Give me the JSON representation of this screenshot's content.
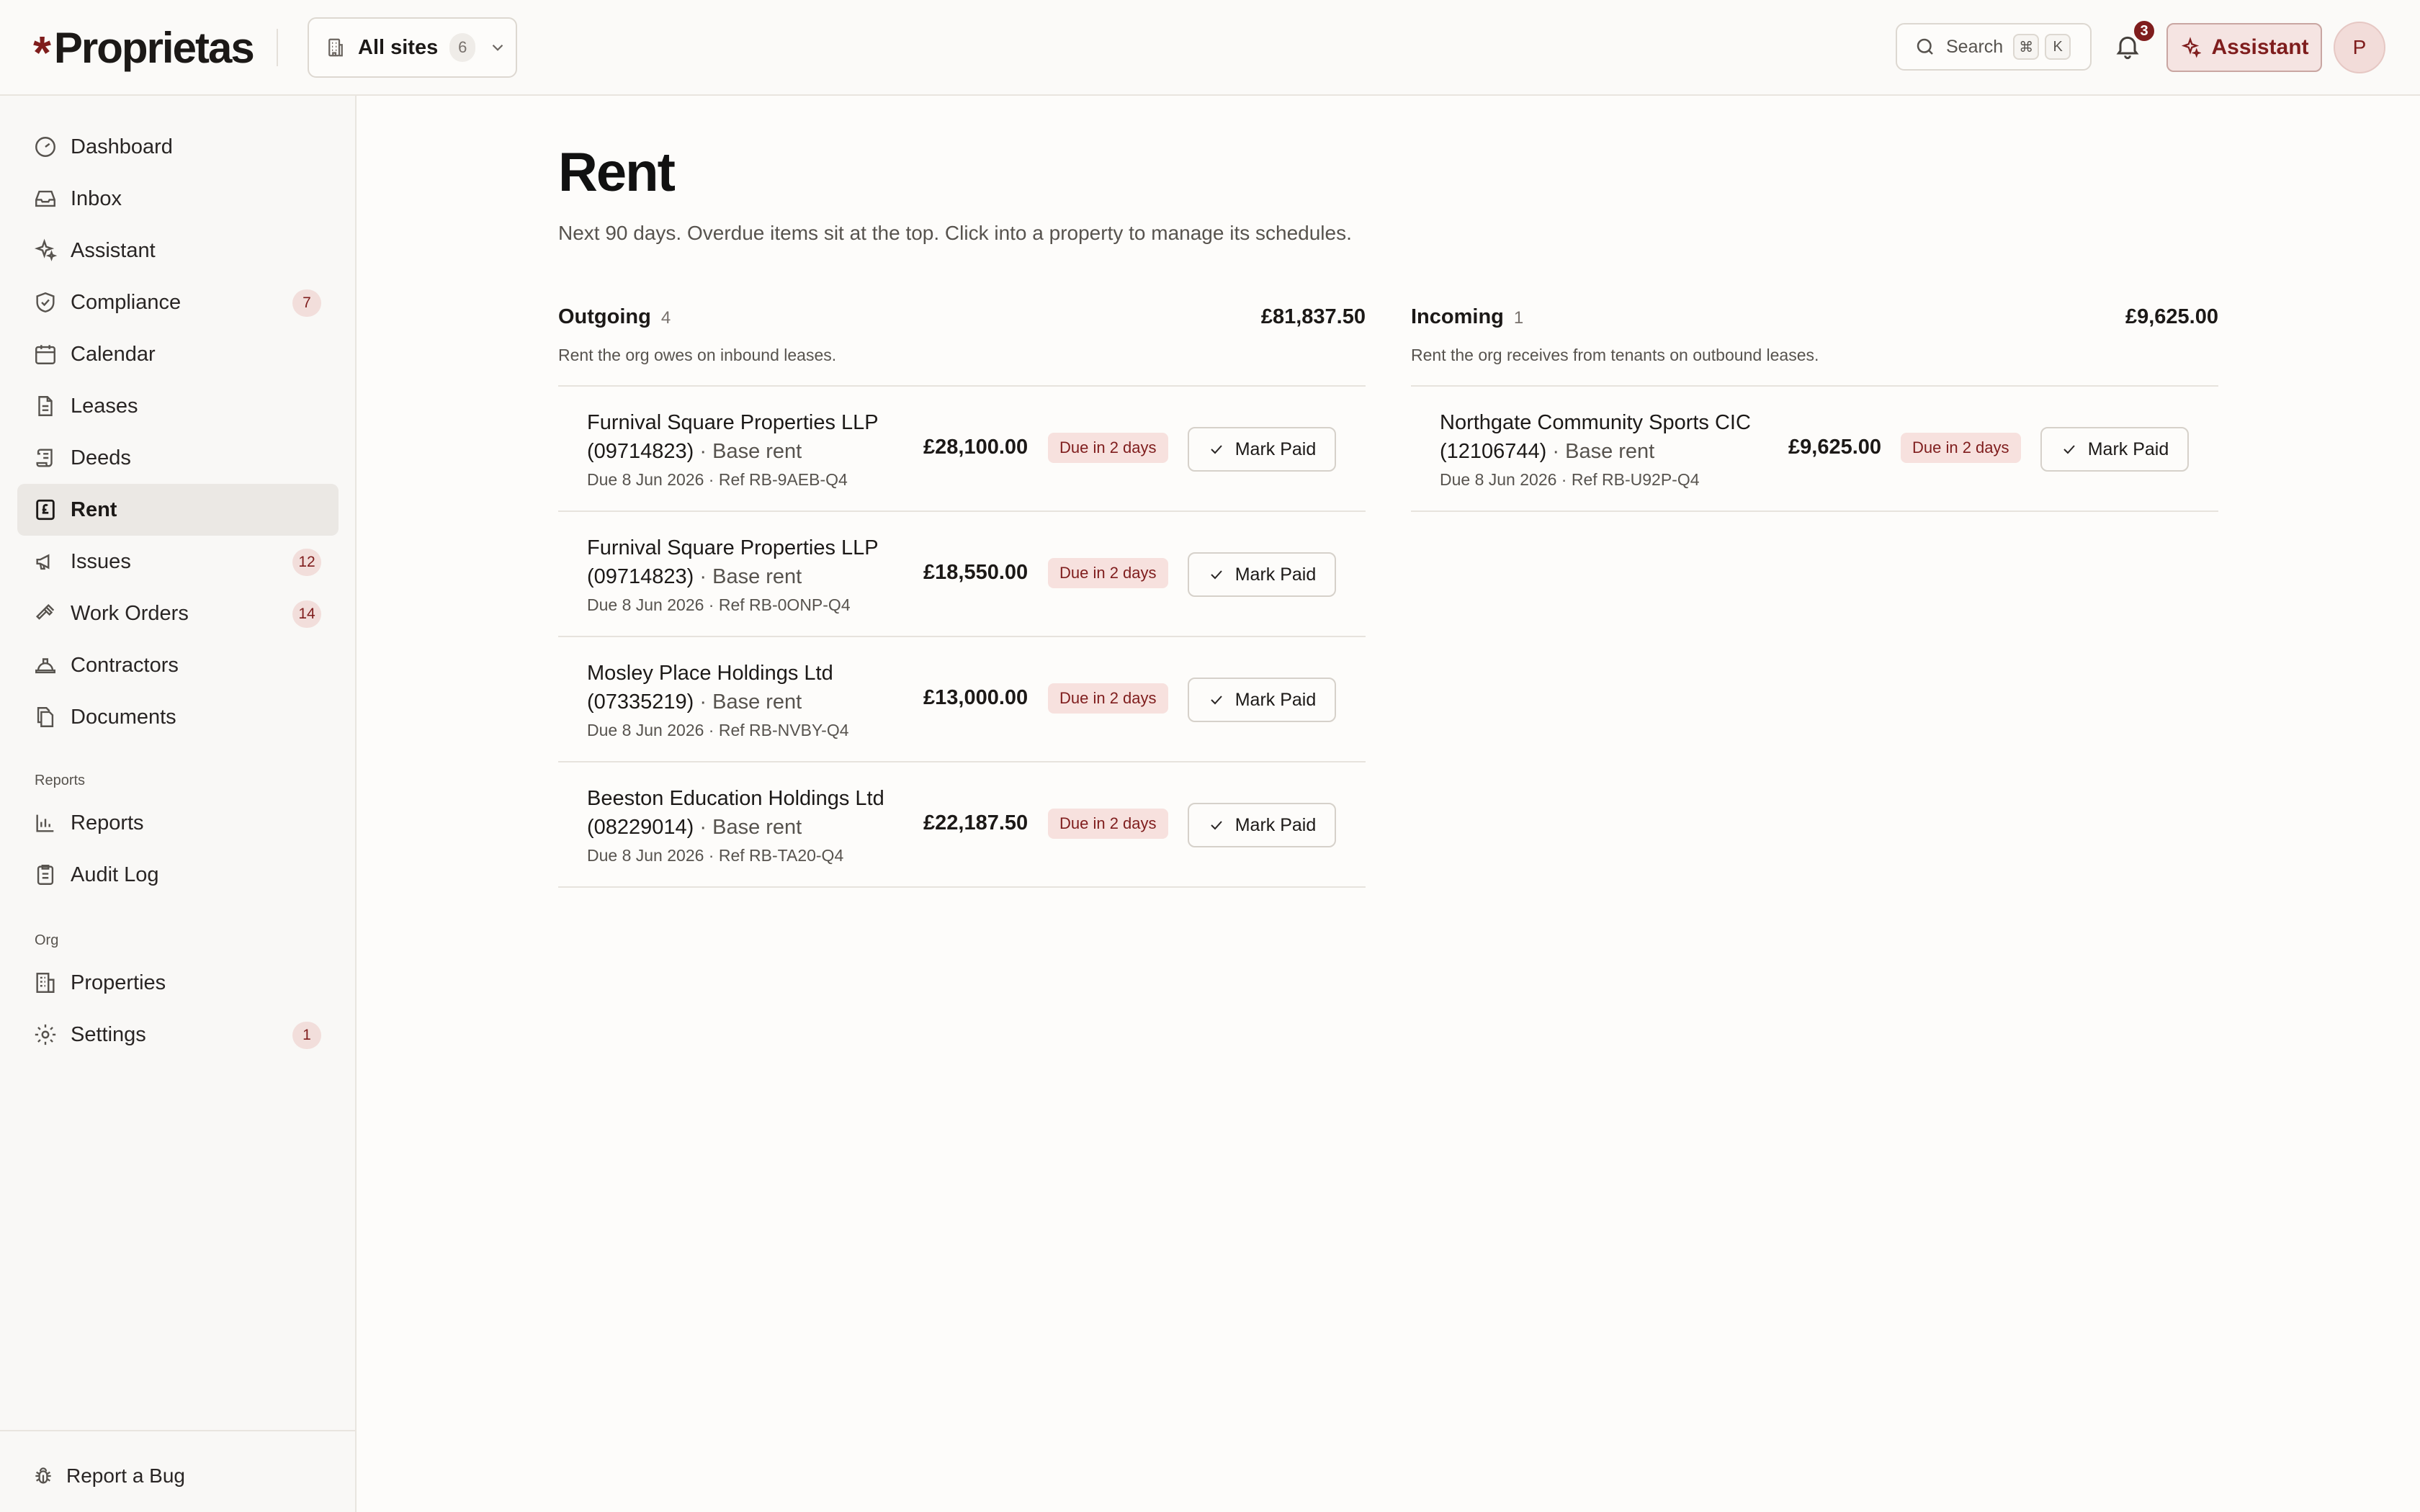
{
  "brand": {
    "star": "*",
    "name": "Proprietas"
  },
  "site_picker": {
    "label": "All sites",
    "count": "6"
  },
  "search": {
    "label": "Search",
    "key1": "⌘",
    "key2": "K"
  },
  "notifications": {
    "count": "3"
  },
  "assistant_button": {
    "label": "Assistant"
  },
  "avatar": {
    "initial": "P"
  },
  "sidebar": {
    "items": [
      {
        "label": "Dashboard",
        "icon": "gauge-icon"
      },
      {
        "label": "Inbox",
        "icon": "inbox-icon"
      },
      {
        "label": "Assistant",
        "icon": "sparkles-icon"
      },
      {
        "label": "Compliance",
        "icon": "shield-check-icon",
        "badge": "7"
      },
      {
        "label": "Calendar",
        "icon": "calendar-icon"
      },
      {
        "label": "Leases",
        "icon": "file-text-icon"
      },
      {
        "label": "Deeds",
        "icon": "scroll-icon"
      },
      {
        "label": "Rent",
        "icon": "receipt-pound-icon",
        "active": true
      },
      {
        "label": "Issues",
        "icon": "megaphone-icon",
        "badge": "12"
      },
      {
        "label": "Work Orders",
        "icon": "hammer-icon",
        "badge": "14"
      },
      {
        "label": "Contractors",
        "icon": "hard-hat-icon"
      },
      {
        "label": "Documents",
        "icon": "files-icon"
      }
    ],
    "reports_section": "Reports",
    "reports_items": [
      {
        "label": "Reports",
        "icon": "bar-chart-icon"
      },
      {
        "label": "Audit Log",
        "icon": "clipboard-list-icon"
      }
    ],
    "org_section": "Org",
    "org_items": [
      {
        "label": "Properties",
        "icon": "building-icon"
      },
      {
        "label": "Settings",
        "icon": "gear-icon",
        "badge": "1"
      }
    ],
    "footer": {
      "label": "Report a Bug",
      "icon": "bug-icon"
    }
  },
  "page": {
    "title": "Rent",
    "subtitle": "Next 90 days. Overdue items sit at the top. Click into a property to manage its schedules."
  },
  "outgoing": {
    "title": "Outgoing",
    "count": "4",
    "total": "£81,837.50",
    "description": "Rent the org owes on inbound leases.",
    "rows": [
      {
        "party_line1": "Furnival Square Properties LLP",
        "party_line2": "(09714823)",
        "kind": " · Base rent",
        "meta": "Due 8 Jun 2026 · Ref RB-9AEB-Q4",
        "amount": "£28,100.00",
        "status": "Due in 2 days",
        "action": "Mark Paid"
      },
      {
        "party_line1": "Furnival Square Properties LLP",
        "party_line2": "(09714823)",
        "kind": " · Base rent",
        "meta": "Due 8 Jun 2026 · Ref RB-0ONP-Q4",
        "amount": "£18,550.00",
        "status": "Due in 2 days",
        "action": "Mark Paid"
      },
      {
        "party_line1": "Mosley Place Holdings Ltd",
        "party_line2": "(07335219)",
        "kind": " · Base rent",
        "meta": "Due 8 Jun 2026 · Ref RB-NVBY-Q4",
        "amount": "£13,000.00",
        "status": "Due in 2 days",
        "action": "Mark Paid"
      },
      {
        "party_line1": "Beeston Education Holdings Ltd",
        "party_line2": "(08229014)",
        "kind": " · Base rent",
        "meta": "Due 8 Jun 2026 · Ref RB-TA20-Q4",
        "amount": "£22,187.50",
        "status": "Due in 2 days",
        "action": "Mark Paid"
      }
    ]
  },
  "incoming": {
    "title": "Incoming",
    "count": "1",
    "total": "£9,625.00",
    "description": "Rent the org receives from tenants on outbound leases.",
    "rows": [
      {
        "party_line1": "Northgate Community Sports CIC",
        "party_line2": "(12106744)",
        "kind": " · Base rent",
        "meta": "Due 8 Jun 2026 · Ref RB-U92P-Q4",
        "amount": "£9,625.00",
        "status": "Due in 2 days",
        "action": "Mark Paid"
      }
    ]
  },
  "colors": {
    "accent": "#7f1d1d",
    "badge_bg": "#f2dedb",
    "status_bg": "#f7e1de"
  }
}
